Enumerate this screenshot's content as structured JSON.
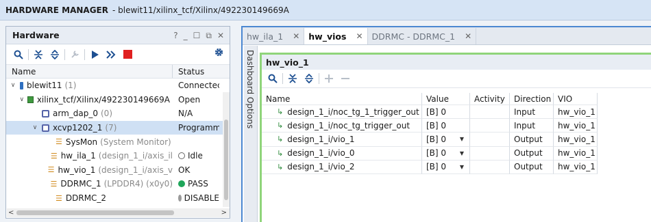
{
  "titlebar": {
    "title": "HARDWARE MANAGER",
    "path": "- blewit11/xilinx_tcf/Xilinx/492230149669A"
  },
  "hardware": {
    "title": "Hardware",
    "window_controls": [
      "?",
      "_",
      "☐",
      "⧉",
      "✕"
    ],
    "columns": {
      "name": "Name",
      "status": "Status"
    },
    "rows": [
      {
        "name": "blewit11",
        "extra": "(1)",
        "status": "Connectec",
        "indent": 0,
        "expand": "∨",
        "icon": "server"
      },
      {
        "name": "xilinx_tcf/Xilinx/492230149669A",
        "extra": "",
        "status": "Open",
        "indent": 1,
        "expand": "∨",
        "icon": "board"
      },
      {
        "name": "arm_dap_0",
        "extra": "(0)",
        "status": "N/A",
        "indent": 2,
        "expand": "",
        "icon": "chip"
      },
      {
        "name": "xcvp1202_1",
        "extra": "(7)",
        "status": "Programm",
        "indent": 2,
        "expand": "∨",
        "icon": "chip"
      },
      {
        "name": "SysMon",
        "extra": "(System Monitor)",
        "status": "",
        "indent": 3,
        "expand": "",
        "icon": "ip"
      },
      {
        "name": "hw_ila_1",
        "extra": "(design_1_i/axis_il",
        "status": "Idle",
        "indent": 3,
        "expand": "",
        "icon": "ip",
        "dot": "idle"
      },
      {
        "name": "hw_vio_1",
        "extra": "(design_1_i/axis_v",
        "status": "OK",
        "indent": 3,
        "expand": "",
        "icon": "ip"
      },
      {
        "name": "DDRMC_1",
        "extra": "(LPDDR4) (x0y0)",
        "status": "PASS",
        "indent": 3,
        "expand": "",
        "icon": "ip",
        "dot": "pass"
      },
      {
        "name": "DDRMC_2",
        "extra": "",
        "status": "DISABLE",
        "indent": 3,
        "expand": "",
        "icon": "ip",
        "dot": "dis"
      }
    ]
  },
  "tabs": [
    {
      "label": "hw_ila_1",
      "active": false,
      "close": "✕"
    },
    {
      "label": "hw_vios",
      "active": true,
      "close": "✕"
    },
    {
      "label": "DDRMC - DDRMC_1",
      "active": false,
      "close": "✕"
    }
  ],
  "dashboard_label": "Dashboard Options",
  "vio": {
    "title": "hw_vio_1",
    "columns": [
      "Name",
      "Value",
      "Activity",
      "Direction",
      "VIO"
    ],
    "rows": [
      {
        "name": "design_1_i/noc_tg_1_trigger_out",
        "value": "[B] 0",
        "dropdown": false,
        "activity": "",
        "direction": "Input",
        "vio": "hw_vio_1"
      },
      {
        "name": "design_1_i/noc_tg_trigger_out",
        "value": "[B] 0",
        "dropdown": false,
        "activity": "",
        "direction": "Input",
        "vio": "hw_vio_1"
      },
      {
        "name": "design_1_i/vio_1",
        "value": "[B] 0",
        "dropdown": true,
        "activity": "",
        "direction": "Output",
        "vio": "hw_vio_1"
      },
      {
        "name": "design_1_i/vio_0",
        "value": "[B] 0",
        "dropdown": true,
        "activity": "",
        "direction": "Output",
        "vio": "hw_vio_1"
      },
      {
        "name": "design_1_i/vio_2",
        "value": "[B] 0",
        "dropdown": true,
        "activity": "",
        "direction": "Output",
        "vio": "hw_vio_1"
      }
    ]
  }
}
